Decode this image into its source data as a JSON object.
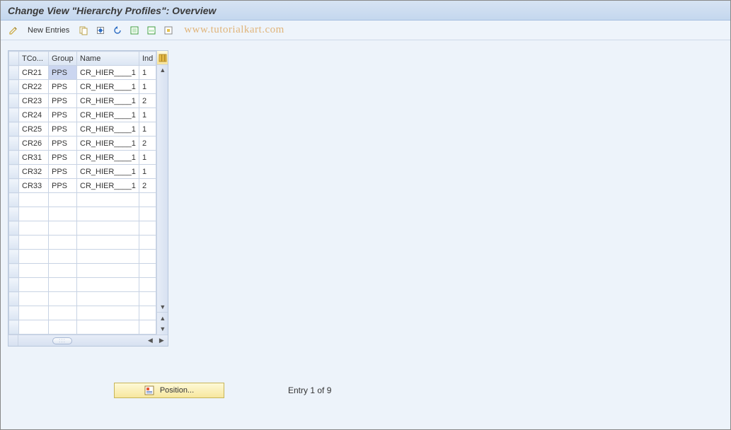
{
  "title": "Change View \"Hierarchy Profiles\": Overview",
  "toolbar": {
    "new_entries_label": "New Entries"
  },
  "watermark": "www.tutorialkart.com",
  "grid": {
    "columns": {
      "tcode": "TCo...",
      "group": "Group",
      "name": "Name",
      "ind": "Ind"
    },
    "rows": [
      {
        "tcode": "CR21",
        "group": "PPS",
        "name": "CR_HIER____1",
        "ind": "1",
        "selected_group": true
      },
      {
        "tcode": "CR22",
        "group": "PPS",
        "name": "CR_HIER____1",
        "ind": "1"
      },
      {
        "tcode": "CR23",
        "group": "PPS",
        "name": "CR_HIER____1",
        "ind": "2"
      },
      {
        "tcode": "CR24",
        "group": "PPS",
        "name": "CR_HIER____1",
        "ind": "1"
      },
      {
        "tcode": "CR25",
        "group": "PPS",
        "name": "CR_HIER____1",
        "ind": "1"
      },
      {
        "tcode": "CR26",
        "group": "PPS",
        "name": "CR_HIER____1",
        "ind": "2"
      },
      {
        "tcode": "CR31",
        "group": "PPS",
        "name": "CR_HIER____1",
        "ind": "1"
      },
      {
        "tcode": "CR32",
        "group": "PPS",
        "name": "CR_HIER____1",
        "ind": "1"
      },
      {
        "tcode": "CR33",
        "group": "PPS",
        "name": "CR_HIER____1",
        "ind": "2"
      }
    ],
    "blank_rows": 10
  },
  "footer": {
    "position_label": "Position...",
    "entry_text": "Entry 1 of 9"
  }
}
